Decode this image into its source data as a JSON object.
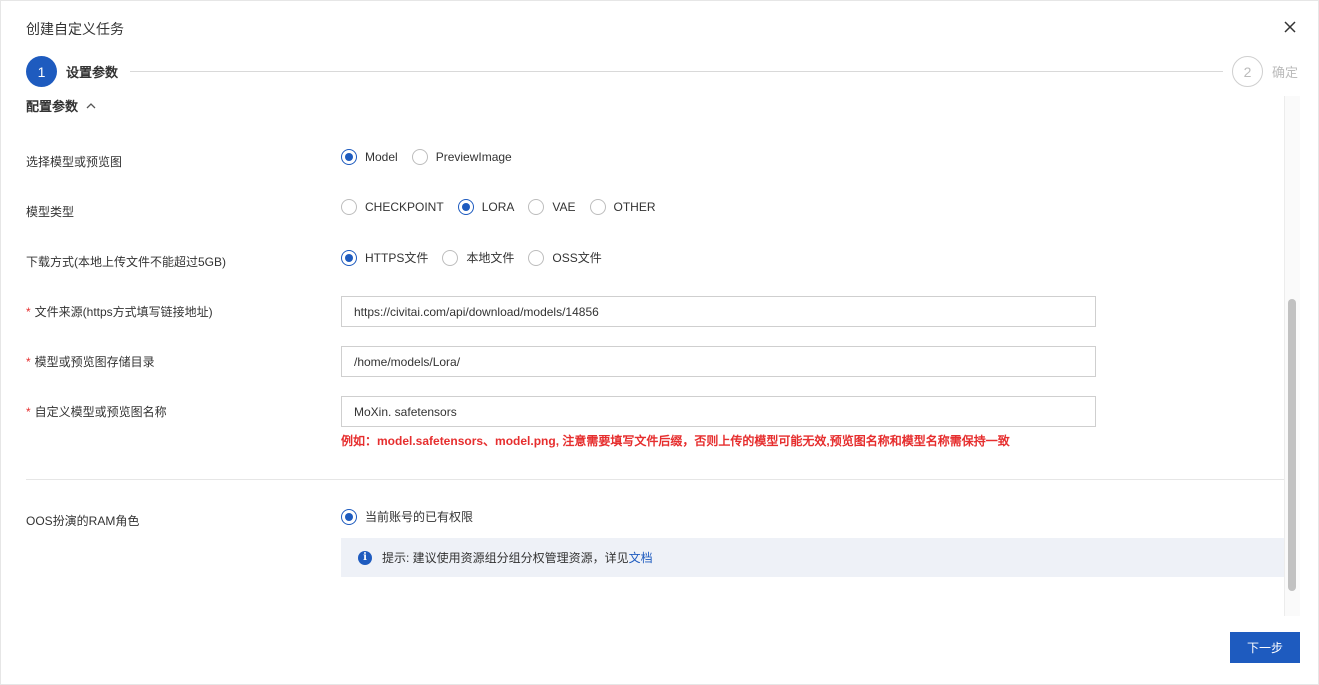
{
  "dialog": {
    "title": "创建自定义任务",
    "next_label": "下一步"
  },
  "stepper": {
    "steps": [
      {
        "number": "1",
        "label": "设置参数",
        "active": true
      },
      {
        "number": "2",
        "label": "确定",
        "active": false
      }
    ]
  },
  "section": {
    "title": "配置参数",
    "expanded": true
  },
  "form": {
    "select_type": {
      "label": "选择模型或预览图",
      "options": [
        "Model",
        "PreviewImage"
      ],
      "selected": "Model"
    },
    "model_type": {
      "label": "模型类型",
      "options": [
        "CHECKPOINT",
        "LORA",
        "VAE",
        "OTHER"
      ],
      "selected": "LORA"
    },
    "download_method": {
      "label": "下载方式(本地上传文件不能超过5GB)",
      "options": [
        "HTTPS文件",
        "本地文件",
        "OSS文件"
      ],
      "selected": "HTTPS文件"
    },
    "file_source": {
      "required_mark": "*",
      "label": "文件来源(https方式填写链接地址)",
      "value": "https://civitai.com/api/download/models/14856"
    },
    "storage_dir": {
      "required_mark": "*",
      "label": "模型或预览图存储目录",
      "value": "/home/models/Lora/"
    },
    "custom_name": {
      "required_mark": "*",
      "label": "自定义模型或预览图名称",
      "value": "MoXin. safetensors",
      "hint": "例如：model.safetensors、model.png, 注意需要填写文件后缀，否则上传的模型可能无效,预览图名称和模型名称需保持一致"
    },
    "ram_role": {
      "label": "OOS扮演的RAM角色",
      "options": [
        "当前账号的已有权限"
      ],
      "selected": "当前账号的已有权限",
      "tip_text": "提示: 建议使用资源组分组分权管理资源，详见",
      "tip_link": "文档"
    }
  },
  "colors": {
    "primary": "#1e5bbf",
    "danger": "#e62e2e",
    "tip_bg": "#eef1f7"
  }
}
